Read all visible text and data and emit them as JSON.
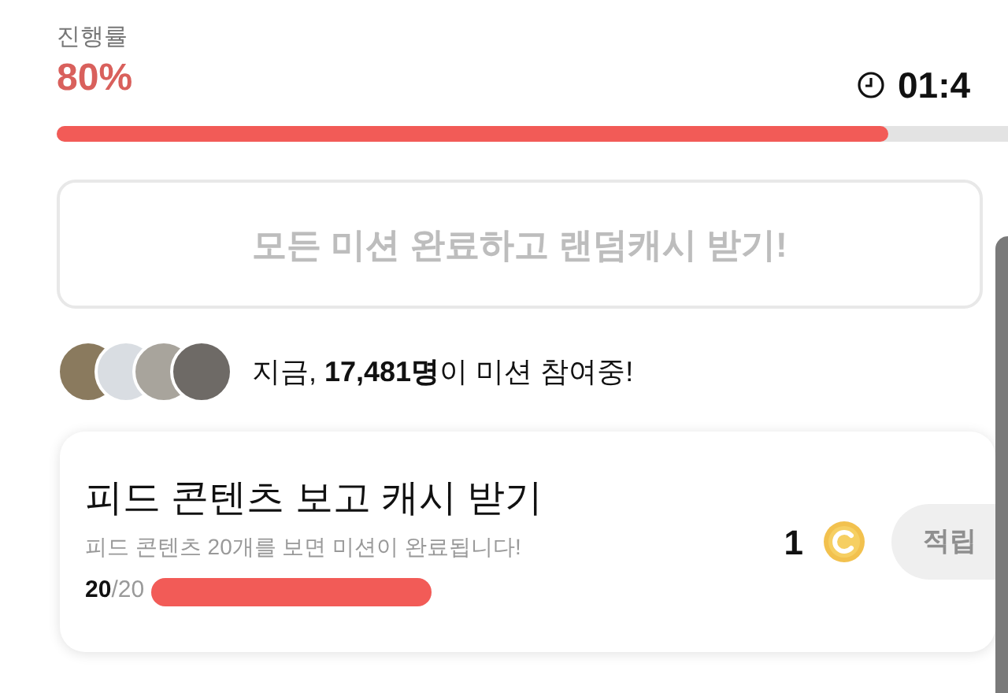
{
  "progress": {
    "label": "진행률",
    "value": "80%",
    "level": 0.8
  },
  "timer": {
    "value": "01:4"
  },
  "complete_all": {
    "label": "모든 미션 완료하고 랜덤캐시 받기!",
    "disabled": true
  },
  "participants": {
    "text": "지금, **17,481명**이 미션 참여중!"
  },
  "missions": [
    {
      "title": "피드 콘텐츠 보고 캐시 받기",
      "description": "피드 콘텐츠 20개를 보면 미션이 완료됩니다!",
      "done": "20",
      "total": "/20",
      "level": 1,
      "reward": "1",
      "button": "적립",
      "disabled": true
    }
  ]
}
